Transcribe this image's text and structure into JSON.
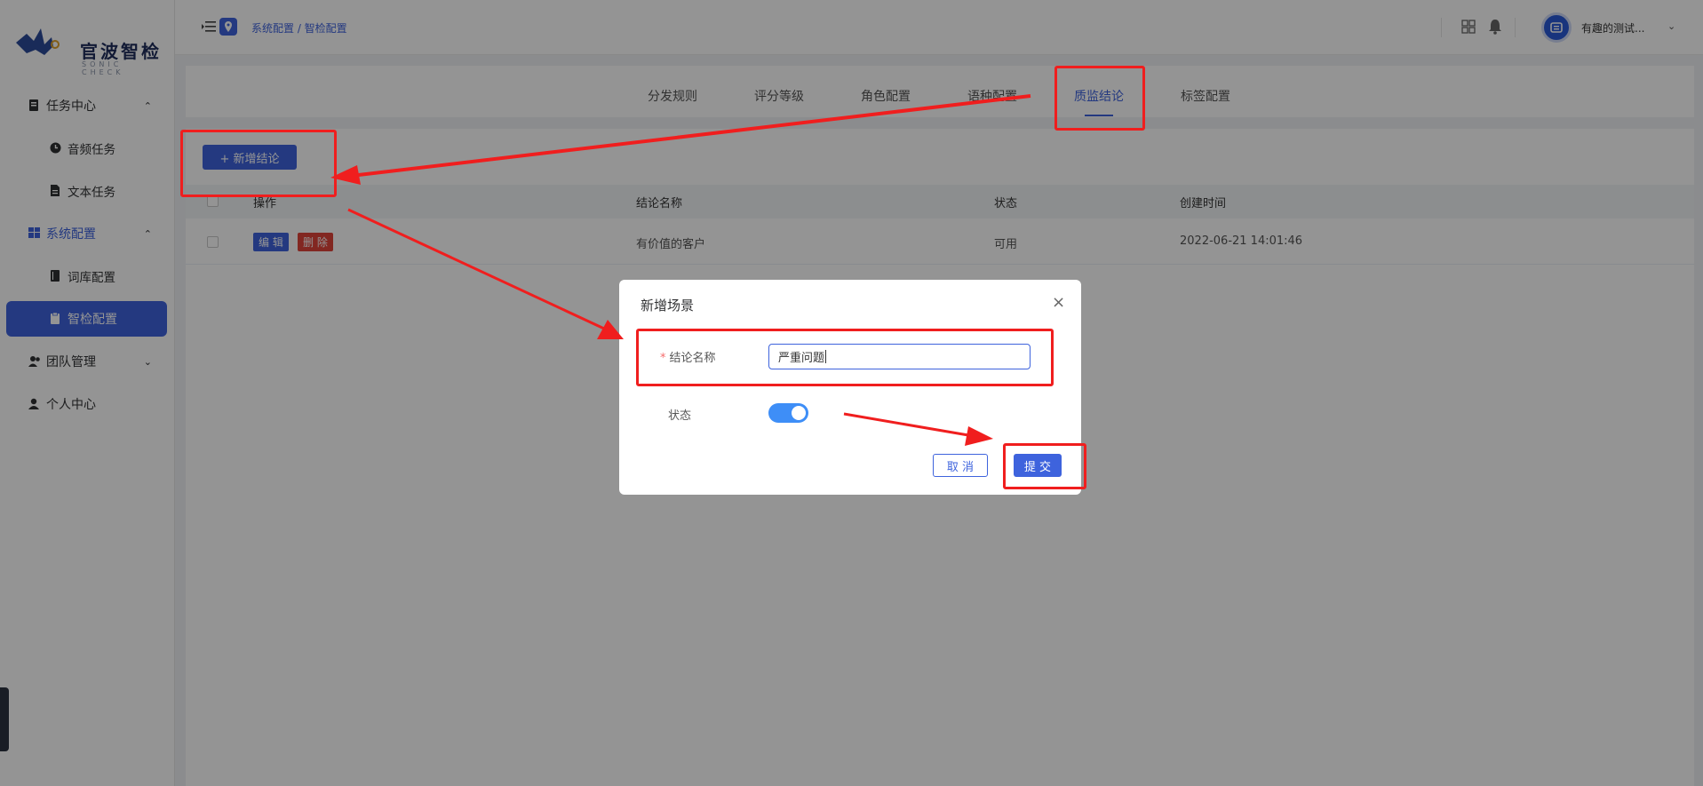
{
  "logo": {
    "text": "官波智检",
    "sub": "SONIC CHECK"
  },
  "sidebar": {
    "items": [
      {
        "label": "任务中心",
        "type": "group",
        "icon": "task-icon",
        "caret": "⌃"
      },
      {
        "label": "音频任务",
        "type": "sub",
        "icon": "clock-icon"
      },
      {
        "label": "文本任务",
        "type": "sub",
        "icon": "document-icon"
      },
      {
        "label": "系统配置",
        "type": "group",
        "icon": "dashboard-icon",
        "caret": "⌃",
        "active": true
      },
      {
        "label": "词库配置",
        "type": "sub",
        "icon": "book-icon"
      },
      {
        "label": "智检配置",
        "type": "sub",
        "icon": "clipboard-icon",
        "selected": true
      },
      {
        "label": "团队管理",
        "type": "group",
        "icon": "team-icon",
        "caret": "⌄"
      },
      {
        "label": "个人中心",
        "type": "group",
        "icon": "user-icon"
      }
    ]
  },
  "header": {
    "breadcrumb": "系统配置 / 智检配置",
    "username": "有趣的测试...",
    "user_caret": "⌄"
  },
  "tabs": [
    {
      "label": "分发规则"
    },
    {
      "label": "评分等级"
    },
    {
      "label": "角色配置"
    },
    {
      "label": "语种配置"
    },
    {
      "label": "质监结论",
      "active": true
    },
    {
      "label": "标签配置"
    }
  ],
  "toolbar": {
    "add_label": "+ 新增结论"
  },
  "table": {
    "headers": [
      "操作",
      "结论名称",
      "状态",
      "创建时间"
    ],
    "rows": [
      {
        "edit": "编 辑",
        "delete": "删 除",
        "name": "有价值的客户",
        "status": "可用",
        "created": "2022-06-21 14:01:46"
      }
    ]
  },
  "modal": {
    "title": "新增场景",
    "close": "×",
    "name_label": "结论名称",
    "required_mark": "*",
    "name_value": "严重问题",
    "status_label": "状态",
    "status_on": true,
    "cancel": "取 消",
    "submit": "提 交"
  },
  "colors": {
    "primary": "#3e63dd",
    "annotation": "#f01e1e",
    "danger": "#e0443a"
  }
}
